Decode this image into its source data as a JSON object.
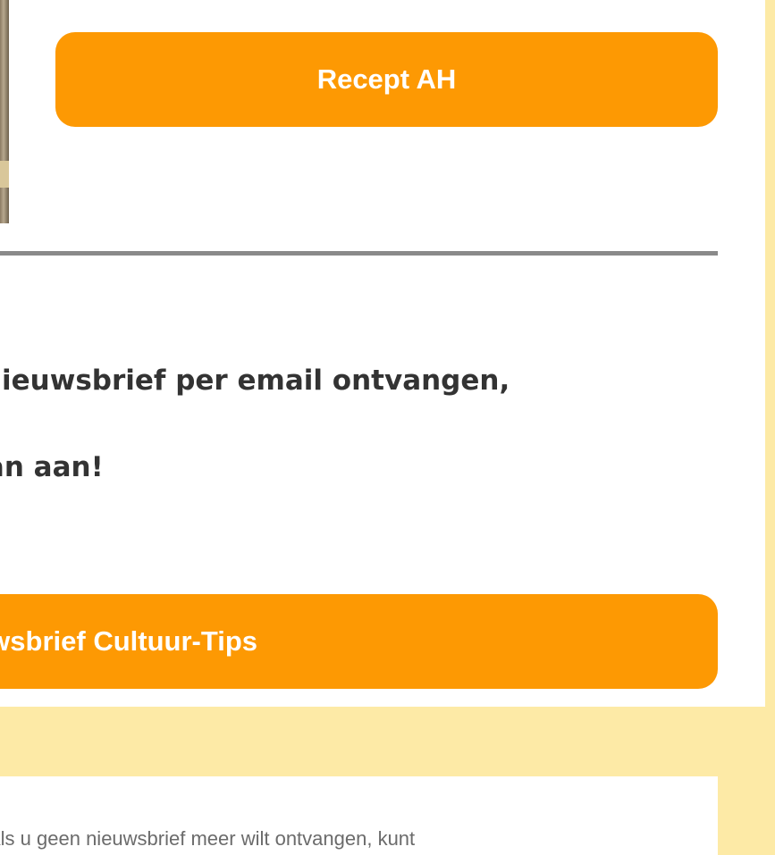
{
  "recipe_section": {
    "button_label": "Recept AH"
  },
  "signup": {
    "line1": "Wilt u de nieuwsbrief per email ontvangen,",
    "line2": "meld u zich dan aan!",
    "button_label": "Nieuwsbrief Cultuur-Tips"
  },
  "footer": {
    "unsubscribe_text": "Als u geen nieuwsbrief meer wilt ontvangen, kunt"
  },
  "colors": {
    "button": "#fd9903",
    "background": "#fdeaa6",
    "divider": "#8a8a8a"
  }
}
